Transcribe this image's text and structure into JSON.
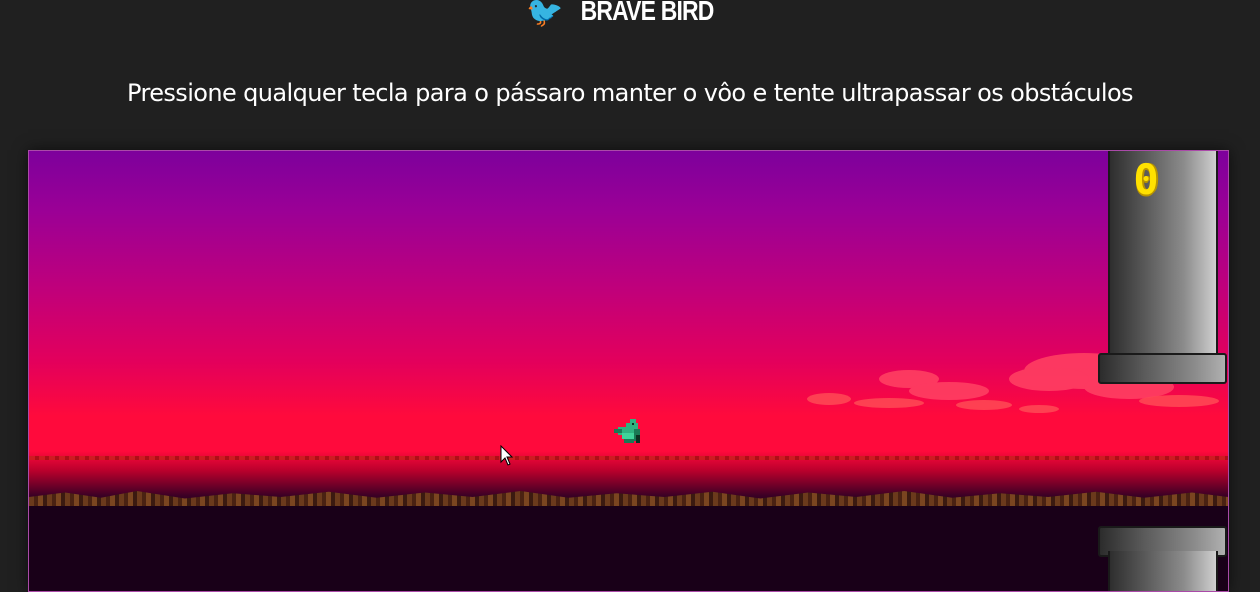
{
  "header": {
    "logo_icon": "🐦",
    "title": "BRAVE BIRD"
  },
  "instructions": "Pressione qualquer tecla para o pássaro manter o vôo e tente ultrapassar os obstáculos",
  "game": {
    "score": "0",
    "sky_colors": [
      "#7d009c",
      "#c1007a",
      "#ff0a3c"
    ],
    "ground_color": "#190018",
    "pipe_color": "#808080",
    "score_color": "#ffe100",
    "bird_color": "#2fb380",
    "bird_icon": "pixel-bird-icon",
    "cursor_icon": "mouse-pointer-icon"
  }
}
